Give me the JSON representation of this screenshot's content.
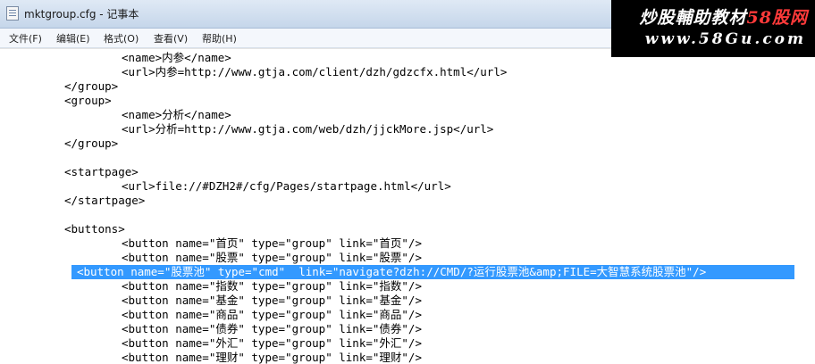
{
  "window": {
    "title": "mktgroup.cfg - 记事本"
  },
  "watermark": {
    "line1_text": "炒股輔助教材",
    "line1_brand": "58股网",
    "line2": "www.58Gu.com"
  },
  "menu": {
    "file": "文件(F)",
    "edit": "编辑(E)",
    "format": "格式(O)",
    "view": "查看(V)",
    "help": "帮助(H)"
  },
  "lines": [
    "<name>内参</name>",
    "<url>内参=http://www.gtja.com/client/dzh/gdzcfx.html</url>",
    "</group>",
    "<group>",
    "<name>分析</name>",
    "<url>分析=http://www.gtja.com/web/dzh/jjckMore.jsp</url>",
    "</group>",
    "",
    "<startpage>",
    "<url>file://#DZH2#/cfg/Pages/startpage.html</url>",
    "</startpage>",
    "",
    "<buttons>",
    "<button name=\"首页\" type=\"group\" link=\"首页\"/>",
    "<button name=\"股票\" type=\"group\" link=\"股票\"/>",
    "<button name=\"股票池\" type=\"cmd\"  link=\"navigate?dzh://CMD/?运行股票池&amp;FILE=大智慧系统股票池\"/>",
    "<button name=\"指数\" type=\"group\" link=\"指数\"/>",
    "<button name=\"基金\" type=\"group\" link=\"基金\"/>",
    "<button name=\"商品\" type=\"group\" link=\"商品\"/>",
    "<button name=\"债券\" type=\"group\" link=\"债券\"/>",
    "<button name=\"外汇\" type=\"group\" link=\"外汇\"/>",
    "<button name=\"理财\" type=\"group\" link=\"理财\"/>"
  ],
  "colors": {
    "selection": "#3399ff",
    "selection_text": "#ffffff",
    "watermark_brand": "#ff3a3a"
  },
  "icons": {
    "app": "notepad-icon"
  }
}
